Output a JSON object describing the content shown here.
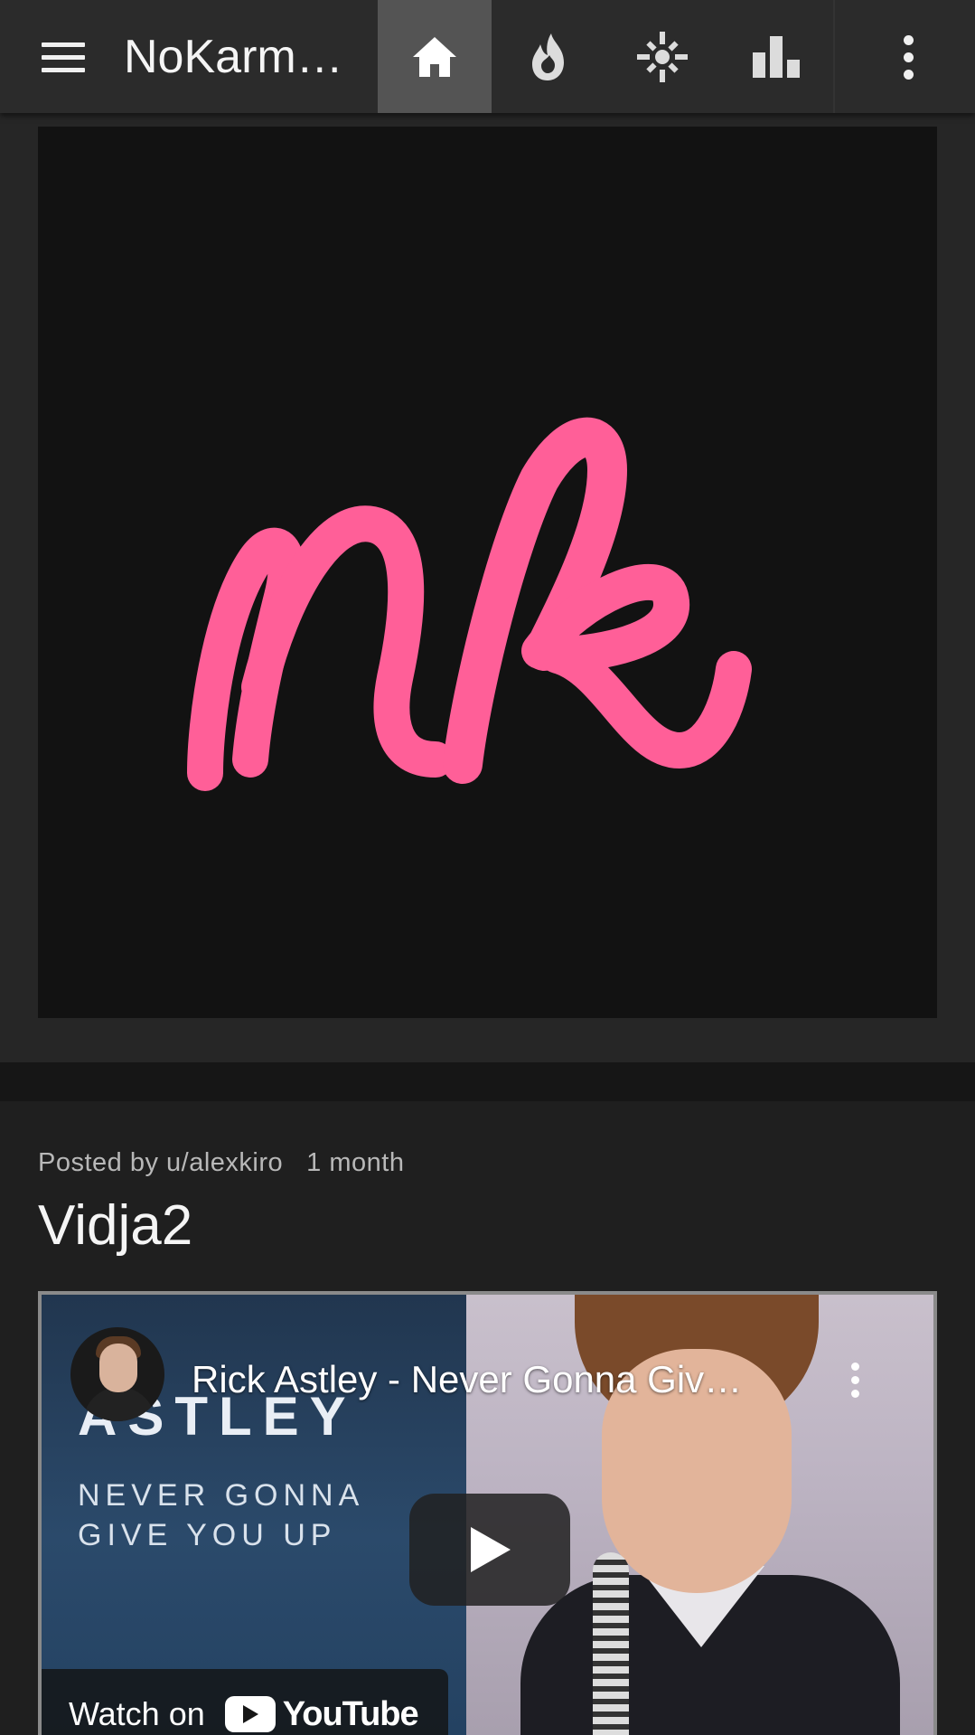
{
  "header": {
    "app_title": "NoKarm…",
    "tabs": [
      {
        "id": "home",
        "icon": "home-icon",
        "active": true
      },
      {
        "id": "hot",
        "icon": "flame-icon",
        "active": false
      },
      {
        "id": "new",
        "icon": "sparkle-icon",
        "active": false
      },
      {
        "id": "top",
        "icon": "bar-chart-icon",
        "active": false
      }
    ]
  },
  "colors": {
    "topbar_bg": "#2b2b2b",
    "active_tab_bg": "#545454",
    "logo_pink": "#ff5f98",
    "background": "#1f1f1f"
  },
  "post1": {
    "image": "nk-logo",
    "logo_text": "nk"
  },
  "post2": {
    "posted_by": "Posted by u/alexkiro",
    "time": "1 month",
    "title": "Vidja2",
    "video": {
      "title": "Rick Astley - Never Gonna Giv…",
      "thumb_big_text": "ASTLEY",
      "thumb_small_line1": "NEVER GONNA",
      "thumb_small_line2": "GIVE YOU UP",
      "watch_on": "Watch on",
      "provider": "YouTube"
    }
  }
}
